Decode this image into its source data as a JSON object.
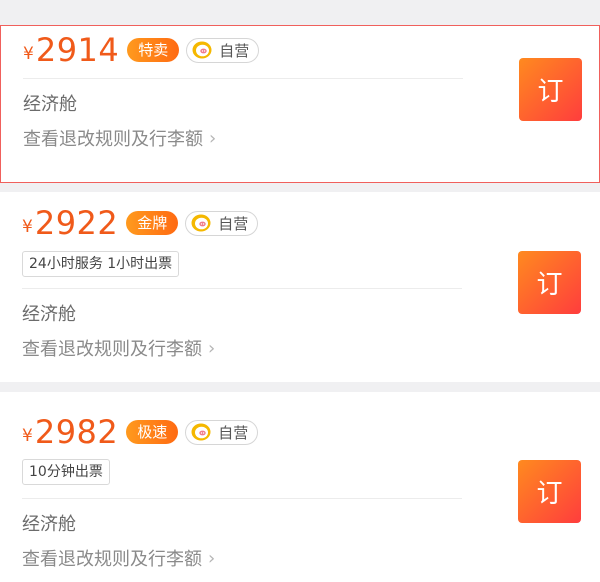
{
  "flights": [
    {
      "currency": "¥",
      "price": "2914",
      "tag": "特卖",
      "self_operated_label": "自营",
      "service_info": "",
      "cabin": "经济舱",
      "rules_link": "查看退改规则及行李额",
      "book_label": "订",
      "selected": true
    },
    {
      "currency": "¥",
      "price": "2922",
      "tag": "金牌",
      "self_operated_label": "自营",
      "service_info": "24小时服务 1小时出票",
      "cabin": "经济舱",
      "rules_link": "查看退改规则及行李额",
      "book_label": "订",
      "selected": false
    },
    {
      "currency": "¥",
      "price": "2982",
      "tag": "极速",
      "self_operated_label": "自营",
      "service_info": "10分钟出票",
      "cabin": "经济舱",
      "rules_link": "查看退改规则及行李额",
      "book_label": "订",
      "selected": false
    }
  ],
  "colors": {
    "price": "#f05a1a",
    "tag_gradient_start": "#ff9a1e",
    "tag_gradient_end": "#ff6a12",
    "book_gradient_start": "#ff8a1f",
    "book_gradient_end": "#ff3d3d",
    "selected_border": "#f0605c"
  },
  "icons": {
    "self_operated_logo": "pig-logo-icon",
    "rules_chevron": "chevron-right-icon"
  }
}
